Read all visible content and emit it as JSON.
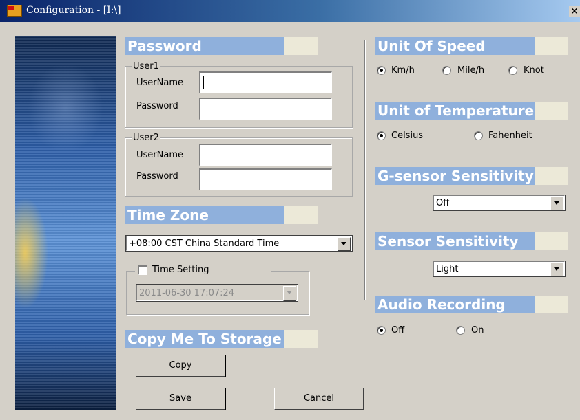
{
  "window": {
    "title": "Configuration - [I:\\]",
    "close_label": "×"
  },
  "password": {
    "heading": "Password",
    "user1": {
      "legend": "User1",
      "username_label": "UserName",
      "username_value": "",
      "password_label": "Password",
      "password_value": ""
    },
    "user2": {
      "legend": "User2",
      "username_label": "UserName",
      "username_value": "",
      "password_label": "Password",
      "password_value": ""
    }
  },
  "time_zone": {
    "heading": "Time Zone",
    "selected": "+08:00 CST China Standard Time",
    "time_setting_label": "Time Setting",
    "time_setting_checked": false,
    "datetime_value": "2011-06-30 17:07:24"
  },
  "copy_section": {
    "heading": "Copy Me To Storage",
    "copy_label": "Copy"
  },
  "footer": {
    "save_label": "Save",
    "cancel_label": "Cancel"
  },
  "unit_of_speed": {
    "heading": "Unit Of Speed",
    "options": [
      "Km/h",
      "Mile/h",
      "Knot"
    ],
    "selected": "Km/h"
  },
  "unit_of_temperature": {
    "heading": "Unit of Temperature",
    "options": [
      "Celsius",
      "Fahenheit"
    ],
    "selected": "Celsius"
  },
  "g_sensor": {
    "heading": "G-sensor Sensitivity",
    "selected": "Off"
  },
  "sensor": {
    "heading": "Sensor Sensitivity",
    "selected": "Light"
  },
  "audio_recording": {
    "heading": "Audio Recording",
    "options": [
      "Off",
      "On"
    ],
    "selected": "Off"
  },
  "colors": {
    "section_header": "#8fb0dc",
    "titlebar_start": "#0a246a",
    "titlebar_end": "#a6caf0",
    "dialog_bg": "#d4d0c8"
  },
  "icons": {
    "app": "car-app-icon",
    "close": "close-icon",
    "dropdown": "chevron-down-icon"
  }
}
